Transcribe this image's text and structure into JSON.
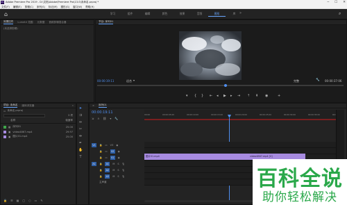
{
  "app": {
    "title": "Adobe Premiere Pro 2019 - D:\\文档\\Adobe\\Premiere Pro\\13.0\\未命名.prproj *",
    "logo_text": "Pr"
  },
  "window_controls": [
    "─",
    "☐",
    "✕"
  ],
  "menu": [
    "文件(F)",
    "编辑(E)",
    "剪辑(C)",
    "序列(S)",
    "标记(M)",
    "图形(G)",
    "窗口(W)",
    "帮助(H)"
  ],
  "workspaces": [
    "学习",
    "组件",
    "编辑",
    "颜色",
    "效果",
    "音频",
    "图形",
    "库"
  ],
  "workspaces_active_index": 6,
  "source_tabs": [
    "效果控件",
    "Lumetri 范围",
    "元数据",
    "音频剪辑混合器"
  ],
  "source_active": "效果控件",
  "source_note": "(未选择剪辑)",
  "program": {
    "title": "节目: 序列01",
    "timecode": "00:00:19:11",
    "fit": "适合",
    "quality": "完整",
    "duration": "00:00:37:06"
  },
  "project": {
    "tab": "项目: 未命名",
    "tab2": "媒体浏览器",
    "file": "未命名.prproj",
    "count": "3 项",
    "col_name": "名称",
    "col_rate": "帧速率",
    "items": [
      {
        "name": "序列01",
        "rate": "25.00",
        "color": "#3fa54a"
      },
      {
        "name": "video4867.mp4",
        "rate": "29.97",
        "color": "#a78be0"
      },
      {
        "name": "图片01.mp4",
        "rate": "25.00",
        "color": "#a78be0"
      }
    ]
  },
  "timeline": {
    "tab": "序列01",
    "timecode": "00:00:19:11",
    "ruler": [
      "00:00",
      "00:00:05:00",
      "00:00:10:00",
      "00:00:15:00",
      "00:00:20:00",
      "00:00:25:00",
      "00:00:30:00",
      "00:00:35:00",
      "00:00:40:00"
    ],
    "tracks": [
      {
        "label": "V3",
        "btn": "V3"
      },
      {
        "label": "V2",
        "btn": "V2"
      },
      {
        "label": "V1",
        "btn": "V1"
      },
      {
        "label": "A1",
        "btn": "A1"
      },
      {
        "label": "A2",
        "btn": "A2"
      },
      {
        "label": "A3",
        "btn": "A3"
      },
      {
        "label": "主声道",
        "btn": "M"
      }
    ],
    "clips": [
      {
        "name": "图片01.mp4"
      },
      {
        "name": "video4867.mp4 [V]"
      }
    ]
  },
  "watermark": {
    "main": "百科全说",
    "sub": "助你轻松解决"
  }
}
